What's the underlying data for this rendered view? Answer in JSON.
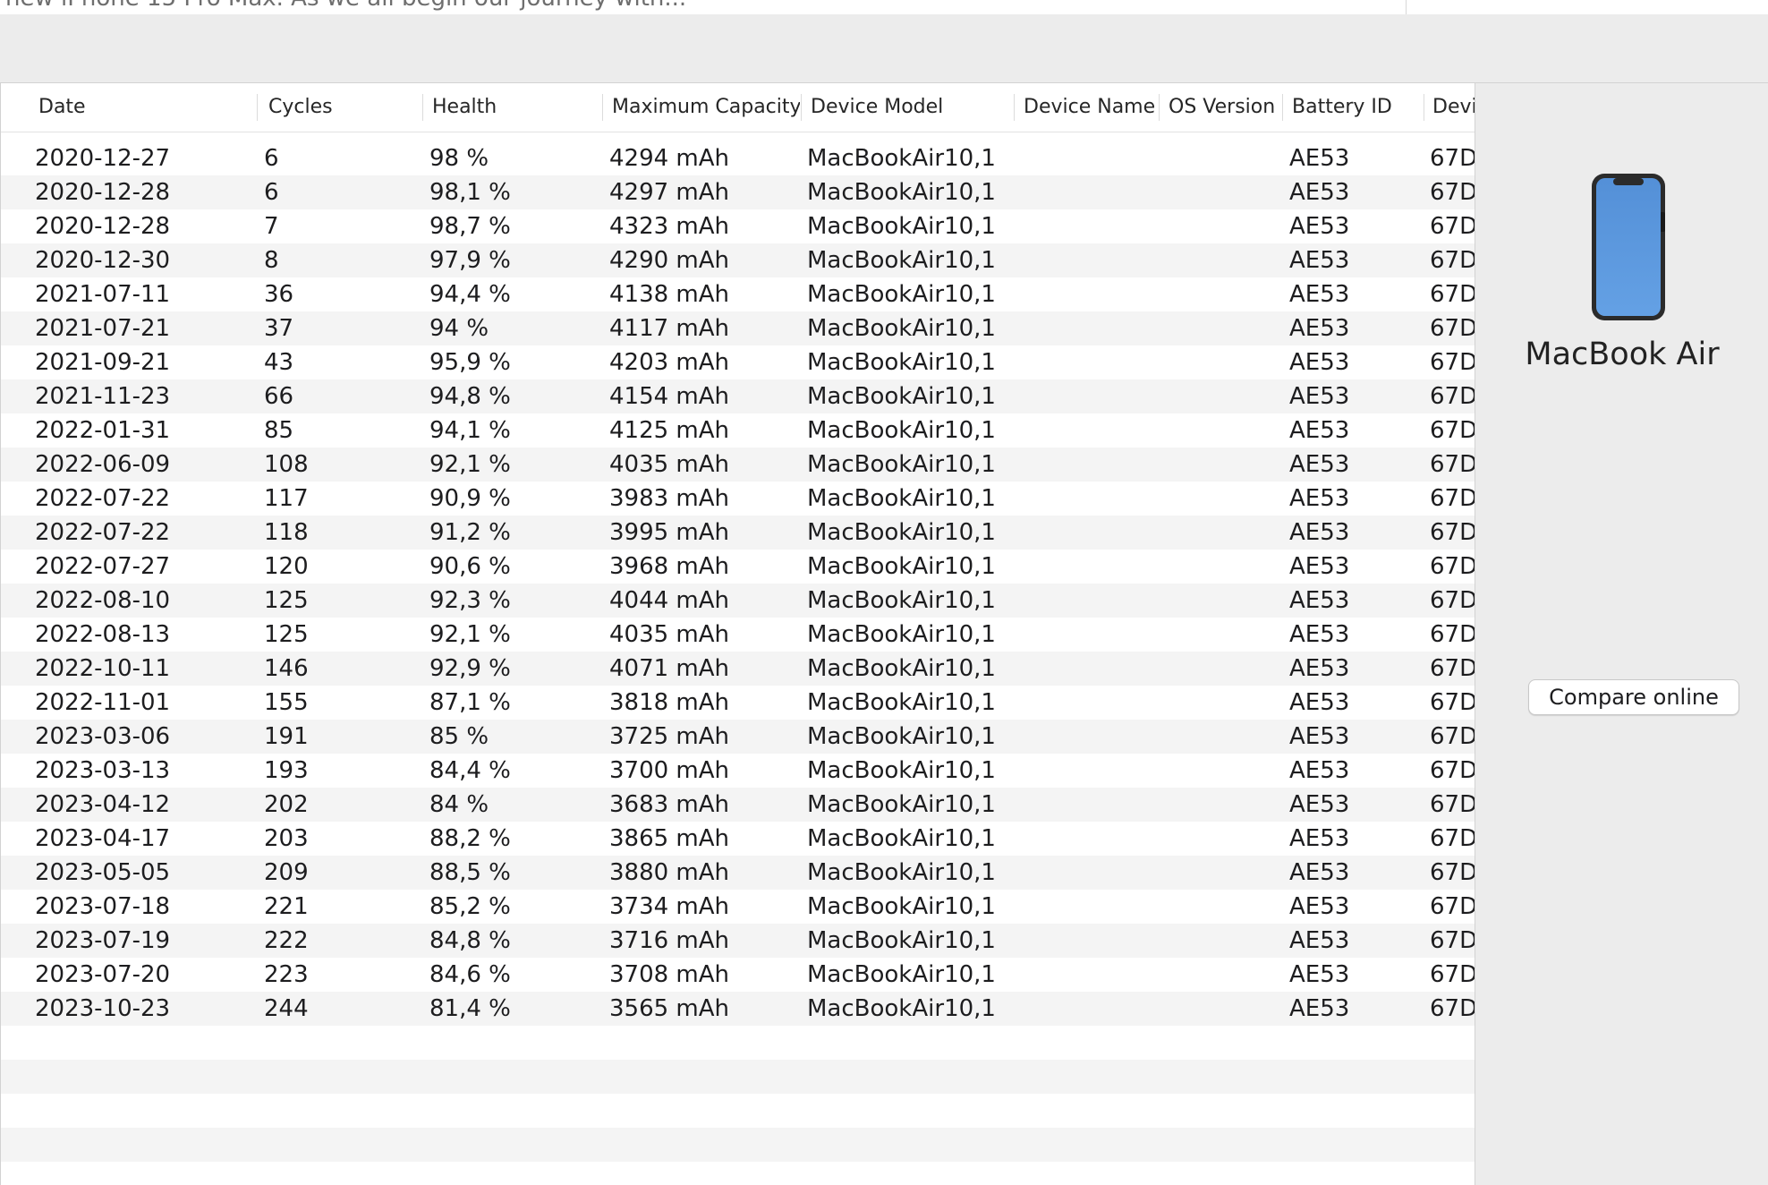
{
  "top_strip": {
    "clipped_text": "new iPhone 15 Pro Max. As we all begin our journey with..."
  },
  "table": {
    "columns": [
      "Date",
      "Cycles",
      "Health",
      "Maximum Capacity",
      "Device Model",
      "Device Name",
      "OS Version",
      "Battery ID",
      "Devi"
    ],
    "rows": [
      [
        "2020-12-27",
        "6",
        "98 %",
        "4294 mAh",
        "MacBookAir10,1",
        "",
        "",
        "AE53",
        "67D"
      ],
      [
        "2020-12-28",
        "6",
        "98,1 %",
        "4297 mAh",
        "MacBookAir10,1",
        "",
        "",
        "AE53",
        "67D"
      ],
      [
        "2020-12-28",
        "7",
        "98,7 %",
        "4323 mAh",
        "MacBookAir10,1",
        "",
        "",
        "AE53",
        "67D"
      ],
      [
        "2020-12-30",
        "8",
        "97,9 %",
        "4290 mAh",
        "MacBookAir10,1",
        "",
        "",
        "AE53",
        "67D"
      ],
      [
        "2021-07-11",
        "36",
        "94,4 %",
        "4138 mAh",
        "MacBookAir10,1",
        "",
        "",
        "AE53",
        "67D"
      ],
      [
        "2021-07-21",
        "37",
        "94 %",
        "4117 mAh",
        "MacBookAir10,1",
        "",
        "",
        "AE53",
        "67D"
      ],
      [
        "2021-09-21",
        "43",
        "95,9 %",
        "4203 mAh",
        "MacBookAir10,1",
        "",
        "",
        "AE53",
        "67D"
      ],
      [
        "2021-11-23",
        "66",
        "94,8 %",
        "4154 mAh",
        "MacBookAir10,1",
        "",
        "",
        "AE53",
        "67D"
      ],
      [
        "2022-01-31",
        "85",
        "94,1 %",
        "4125 mAh",
        "MacBookAir10,1",
        "",
        "",
        "AE53",
        "67D"
      ],
      [
        "2022-06-09",
        "108",
        "92,1 %",
        "4035 mAh",
        "MacBookAir10,1",
        "",
        "",
        "AE53",
        "67D"
      ],
      [
        "2022-07-22",
        "117",
        "90,9 %",
        "3983 mAh",
        "MacBookAir10,1",
        "",
        "",
        "AE53",
        "67D"
      ],
      [
        "2022-07-22",
        "118",
        "91,2 %",
        "3995 mAh",
        "MacBookAir10,1",
        "",
        "",
        "AE53",
        "67D"
      ],
      [
        "2022-07-27",
        "120",
        "90,6 %",
        "3968 mAh",
        "MacBookAir10,1",
        "",
        "",
        "AE53",
        "67D"
      ],
      [
        "2022-08-10",
        "125",
        "92,3 %",
        "4044 mAh",
        "MacBookAir10,1",
        "",
        "",
        "AE53",
        "67D"
      ],
      [
        "2022-08-13",
        "125",
        "92,1 %",
        "4035 mAh",
        "MacBookAir10,1",
        "",
        "",
        "AE53",
        "67D"
      ],
      [
        "2022-10-11",
        "146",
        "92,9 %",
        "4071 mAh",
        "MacBookAir10,1",
        "",
        "",
        "AE53",
        "67D"
      ],
      [
        "2022-11-01",
        "155",
        "87,1 %",
        "3818 mAh",
        "MacBookAir10,1",
        "",
        "",
        "AE53",
        "67D"
      ],
      [
        "2023-03-06",
        "191",
        "85 %",
        "3725 mAh",
        "MacBookAir10,1",
        "",
        "",
        "AE53",
        "67D"
      ],
      [
        "2023-03-13",
        "193",
        "84,4 %",
        "3700 mAh",
        "MacBookAir10,1",
        "",
        "",
        "AE53",
        "67D"
      ],
      [
        "2023-04-12",
        "202",
        "84 %",
        "3683 mAh",
        "MacBookAir10,1",
        "",
        "",
        "AE53",
        "67D"
      ],
      [
        "2023-04-17",
        "203",
        "88,2 %",
        "3865 mAh",
        "MacBookAir10,1",
        "",
        "",
        "AE53",
        "67D"
      ],
      [
        "2023-05-05",
        "209",
        "88,5 %",
        "3880 mAh",
        "MacBookAir10,1",
        "",
        "",
        "AE53",
        "67D"
      ],
      [
        "2023-07-18",
        "221",
        "85,2 %",
        "3734 mAh",
        "MacBookAir10,1",
        "",
        "",
        "AE53",
        "67D"
      ],
      [
        "2023-07-19",
        "222",
        "84,8 %",
        "3716 mAh",
        "MacBookAir10,1",
        "",
        "",
        "AE53",
        "67D"
      ],
      [
        "2023-07-20",
        "223",
        "84,6 %",
        "3708 mAh",
        "MacBookAir10,1",
        "",
        "",
        "AE53",
        "67D"
      ],
      [
        "2023-10-23",
        "244",
        "81,4 %",
        "3565 mAh",
        "MacBookAir10,1",
        "",
        "",
        "AE53",
        "67D"
      ]
    ]
  },
  "side_panel": {
    "device_icon": "phone-icon",
    "device_name": "MacBook Air",
    "compare_label": "Compare online"
  },
  "colors": {
    "row_stripe": "#f4f4f4",
    "panel_bg": "#ececec",
    "phone_screen": "#5b97dc",
    "phone_frame": "#2b2b2b"
  }
}
